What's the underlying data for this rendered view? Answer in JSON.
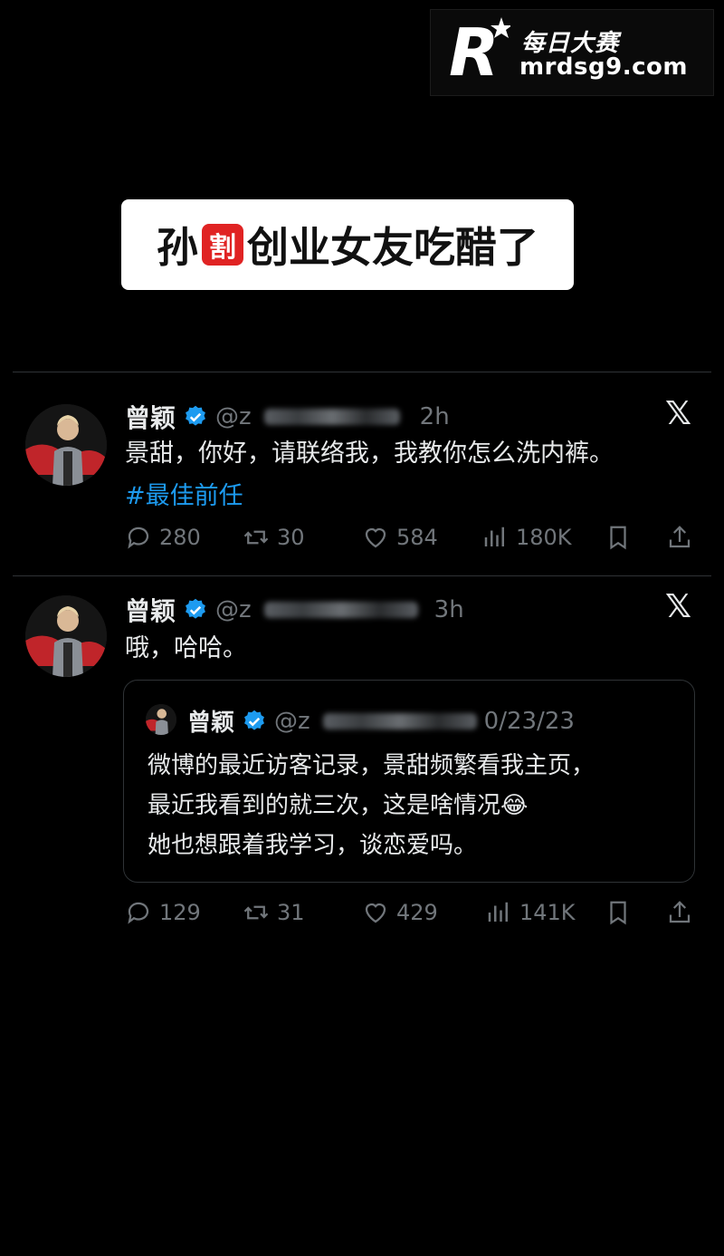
{
  "watermark": {
    "brand_top": "每日大赛",
    "brand_url": "mrdsg9.com"
  },
  "banner": {
    "left": "孙",
    "middle": "割",
    "right": "创业女友吃醋了"
  },
  "tweets": [
    {
      "name": "曾颖",
      "handle": "@z",
      "time": "2h",
      "text": "景甜，你好，请联络我，我教你怎么洗内裤。",
      "hashtag": "#最佳前任",
      "stats": {
        "replies": "280",
        "retweets": "30",
        "likes": "584",
        "views": "180K"
      }
    },
    {
      "name": "曾颖",
      "handle": "@z",
      "time": "3h",
      "text": "哦，哈哈。",
      "quote": {
        "name": "曾颖",
        "handle": "@z",
        "date": "0/23/23",
        "lines": [
          "微博的最近访客记录，景甜频繁看我主页，",
          "最近我看到的就三次，这是啥情况😂",
          "她也想跟着我学习，谈恋爱吗。"
        ]
      },
      "stats": {
        "replies": "129",
        "retweets": "31",
        "likes": "429",
        "views": "141K"
      }
    }
  ],
  "colors": {
    "background": "#000000",
    "link": "#1d9bf0",
    "muted": "#71767b",
    "banner_accent": "#e02323"
  },
  "icons": [
    "reply-icon",
    "retweet-icon",
    "like-icon",
    "views-icon",
    "bookmark-icon",
    "share-icon",
    "verified-icon",
    "x-logo-icon"
  ]
}
